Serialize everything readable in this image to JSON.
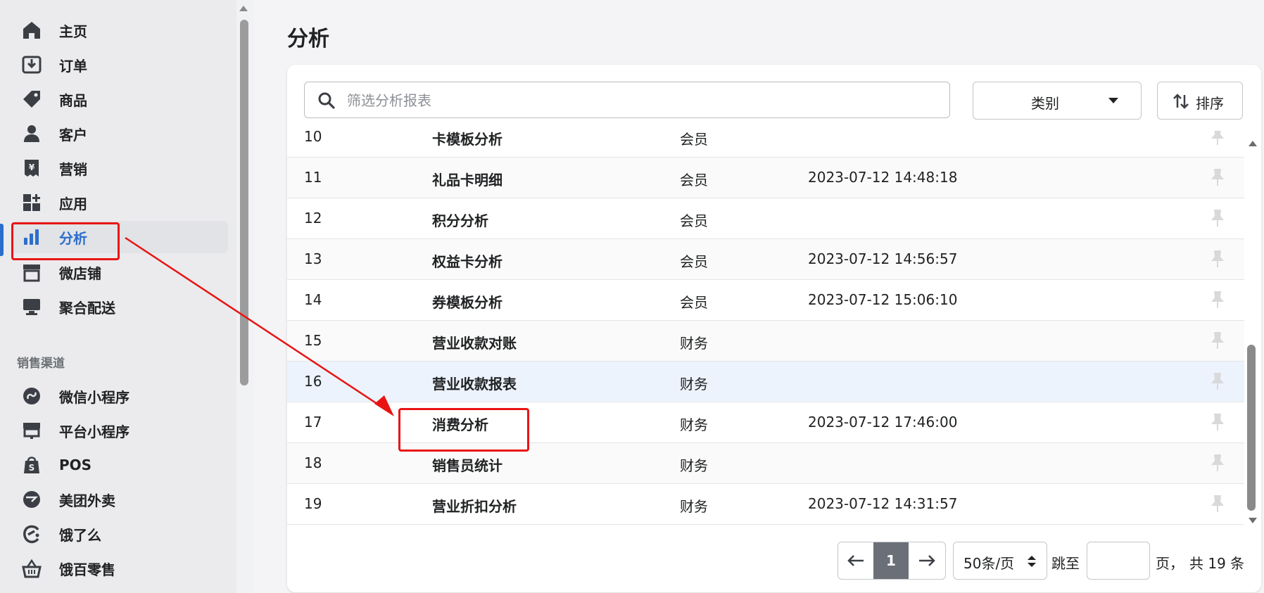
{
  "sidebar": {
    "items": [
      {
        "label": "主页",
        "icon": "home-icon"
      },
      {
        "label": "订单",
        "icon": "order-icon"
      },
      {
        "label": "商品",
        "icon": "tag-icon"
      },
      {
        "label": "客户",
        "icon": "person-icon"
      },
      {
        "label": "营销",
        "icon": "receipt-icon"
      },
      {
        "label": "应用",
        "icon": "apps-icon"
      },
      {
        "label": "分析",
        "icon": "bar-chart-icon",
        "active": true
      },
      {
        "label": "微店铺",
        "icon": "store-icon"
      },
      {
        "label": "聚合配送",
        "icon": "monitor-icon"
      }
    ],
    "channels_title": "销售渠道",
    "channels": [
      {
        "label": "微信小程序",
        "icon": "miniprogram-icon"
      },
      {
        "label": "平台小程序",
        "icon": "platform-store-icon"
      },
      {
        "label": "POS",
        "icon": "pos-bag-icon"
      },
      {
        "label": "美团外卖",
        "icon": "meituan-icon"
      },
      {
        "label": "饿了么",
        "icon": "eleme-icon"
      },
      {
        "label": "饿百零售",
        "icon": "basket-icon"
      }
    ]
  },
  "page": {
    "title": "分析"
  },
  "toolbar": {
    "search_placeholder": "筛选分析报表",
    "category_label": "类别",
    "sort_label": "排序"
  },
  "table": {
    "rows": [
      {
        "idx": "10",
        "name": "卡模板分析",
        "category": "会员",
        "time": ""
      },
      {
        "idx": "11",
        "name": "礼品卡明细",
        "category": "会员",
        "time": "2023-07-12 14:48:18"
      },
      {
        "idx": "12",
        "name": "积分分析",
        "category": "会员",
        "time": ""
      },
      {
        "idx": "13",
        "name": "权益卡分析",
        "category": "会员",
        "time": "2023-07-12 14:56:57"
      },
      {
        "idx": "14",
        "name": "券模板分析",
        "category": "会员",
        "time": "2023-07-12 15:06:10"
      },
      {
        "idx": "15",
        "name": "营业收款对账",
        "category": "财务",
        "time": ""
      },
      {
        "idx": "16",
        "name": "营业收款报表",
        "category": "财务",
        "time": ""
      },
      {
        "idx": "17",
        "name": "消费分析",
        "category": "财务",
        "time": "2023-07-12 17:46:00"
      },
      {
        "idx": "18",
        "name": "销售员统计",
        "category": "财务",
        "time": ""
      },
      {
        "idx": "19",
        "name": "营业折扣分析",
        "category": "财务",
        "time": "2023-07-12 14:31:57"
      }
    ]
  },
  "pagination": {
    "current_page": "1",
    "per_page": "50条/页",
    "jump_label": "跳至",
    "page_unit": "页，",
    "total": "共 19 条"
  },
  "colors": {
    "accent": "#2c6ecb",
    "annotation": "#e81414",
    "highlight_row": "#edf3fc"
  }
}
